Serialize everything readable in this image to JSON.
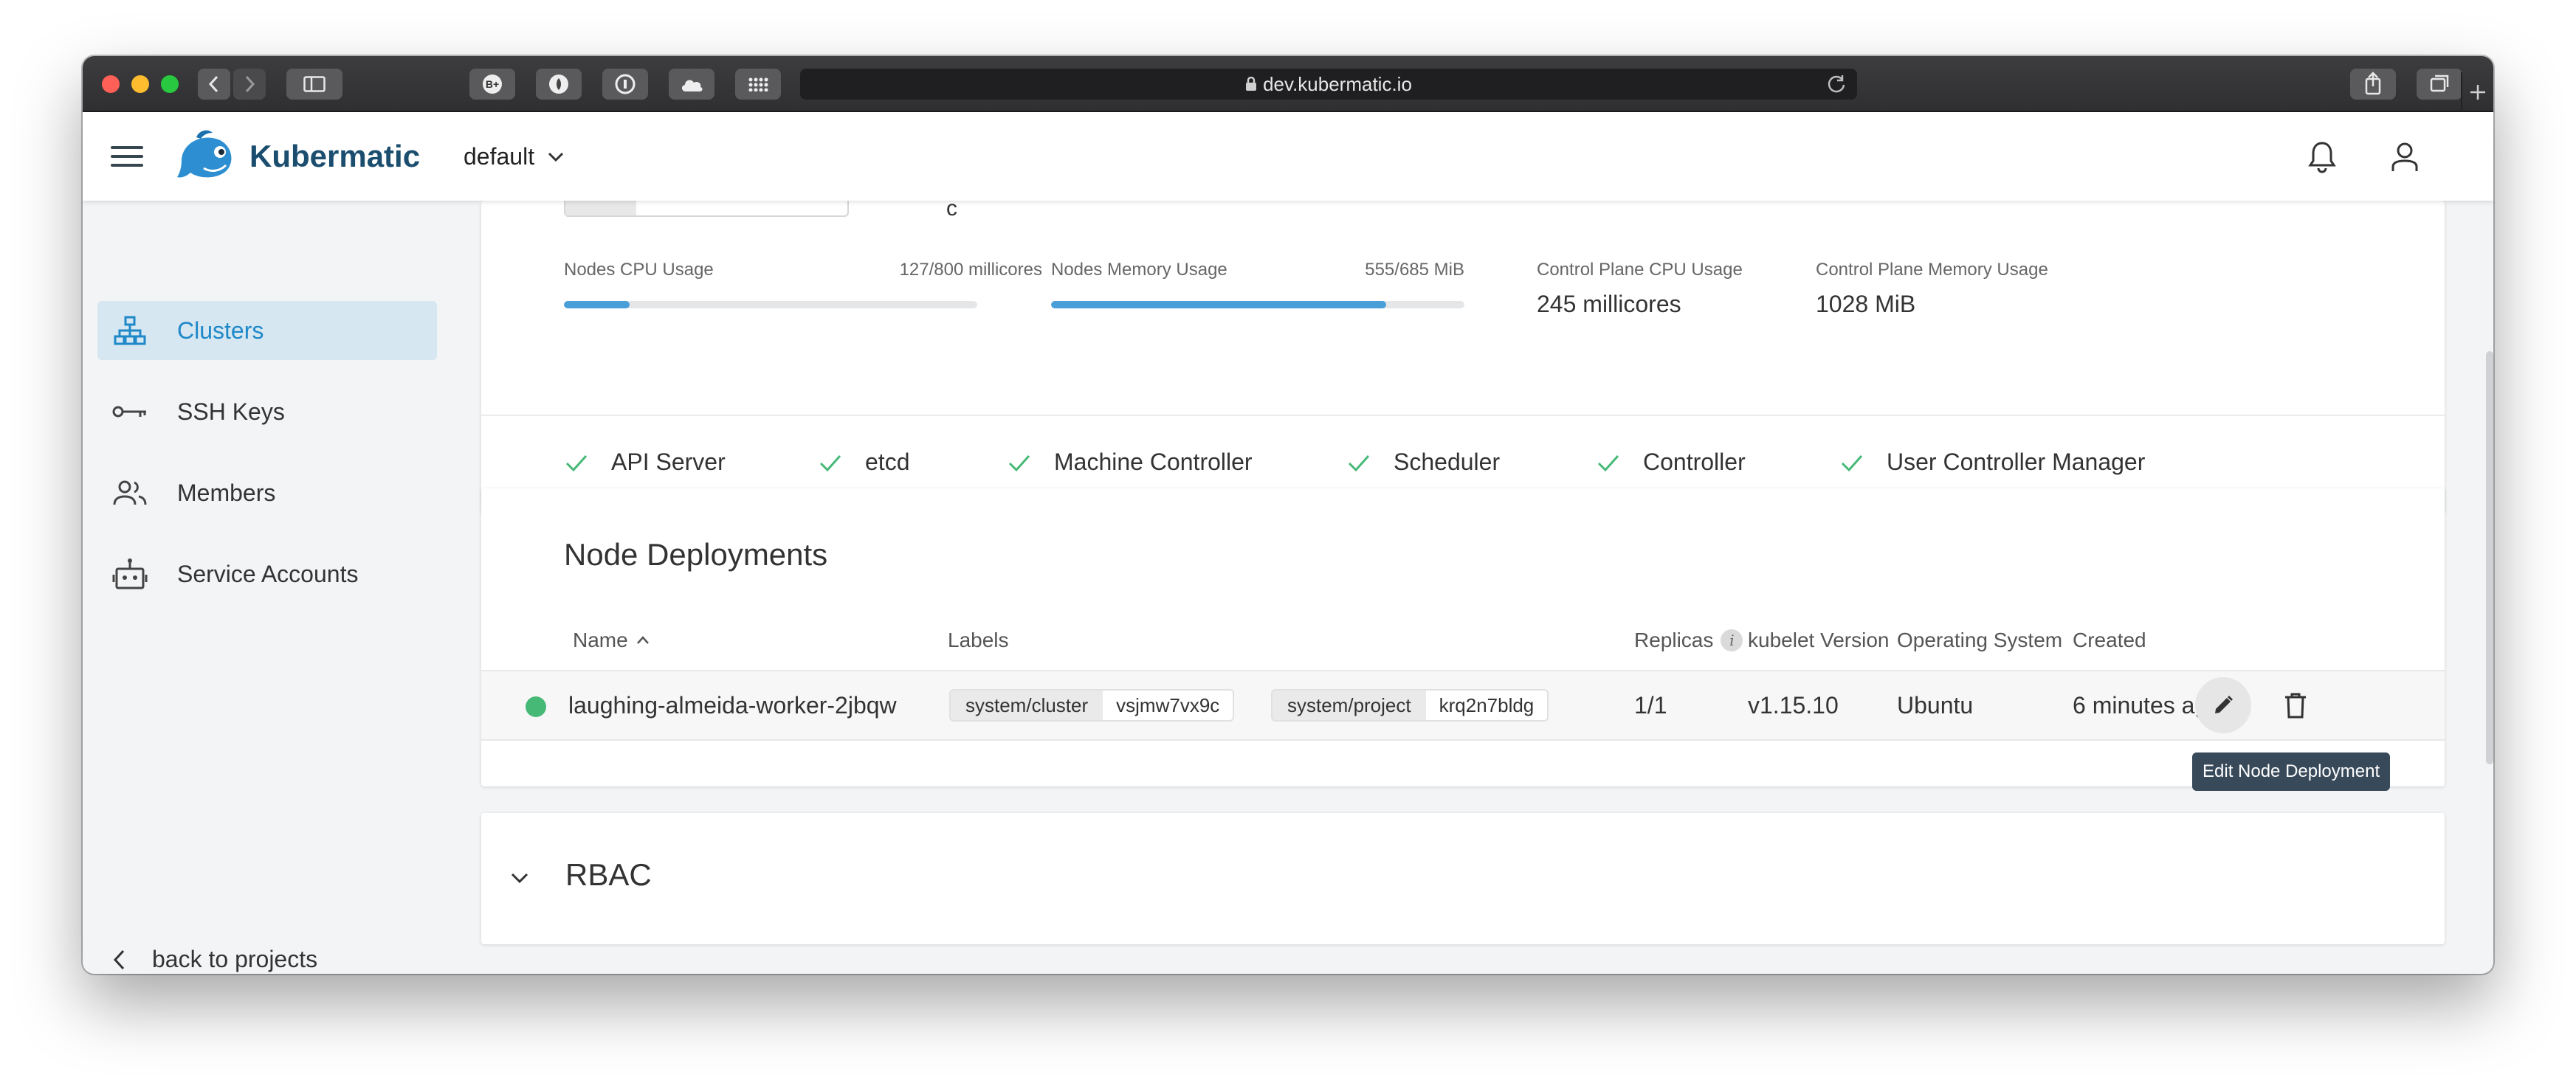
{
  "browser": {
    "url": "dev.kubermatic.io"
  },
  "header": {
    "brand": "Kubermatic",
    "project": "default"
  },
  "sidebar": {
    "items": [
      {
        "label": "Clusters"
      },
      {
        "label": "SSH Keys"
      },
      {
        "label": "Members"
      },
      {
        "label": "Service Accounts"
      }
    ],
    "back_label": "back to projects"
  },
  "cluster_card": {
    "partial_text": "c",
    "metrics": {
      "nodes_cpu": {
        "label": "Nodes CPU Usage",
        "value_text": "127/800 millicores",
        "used": 127,
        "total": 800
      },
      "nodes_memory": {
        "label": "Nodes Memory Usage",
        "value_text": "555/685 MiB",
        "used": 555,
        "total": 685
      },
      "cp_cpu": {
        "label": "Control Plane CPU Usage",
        "value": "245 millicores"
      },
      "cp_memory": {
        "label": "Control Plane Memory Usage",
        "value": "1028 MiB"
      }
    },
    "health": [
      "API Server",
      "etcd",
      "Machine Controller",
      "Scheduler",
      "Controller",
      "User Controller Manager"
    ]
  },
  "node_deployments": {
    "title": "Node Deployments",
    "columns": {
      "name": "Name",
      "labels": "Labels",
      "replicas": "Replicas",
      "kubelet": "kubelet Version",
      "os": "Operating System",
      "created": "Created"
    },
    "rows": [
      {
        "name": "laughing-almeida-worker-2jbqw",
        "labels": [
          {
            "key": "system/cluster",
            "value": "vsjmw7vx9c"
          },
          {
            "key": "system/project",
            "value": "krq2n7bldg"
          }
        ],
        "replicas": "1/1",
        "kubelet": "v1.15.10",
        "os": "Ubuntu",
        "created": "6 minutes ago",
        "status_color": "#47b977"
      }
    ],
    "edit_tooltip": "Edit Node Deployment"
  },
  "rbac": {
    "title": "RBAC"
  },
  "colors": {
    "accent": "#1e88c8",
    "active_nav_bg": "#d6e7f1",
    "progress": "#4a9fd8",
    "success": "#47b977",
    "tooltip_bg": "#38495a"
  }
}
